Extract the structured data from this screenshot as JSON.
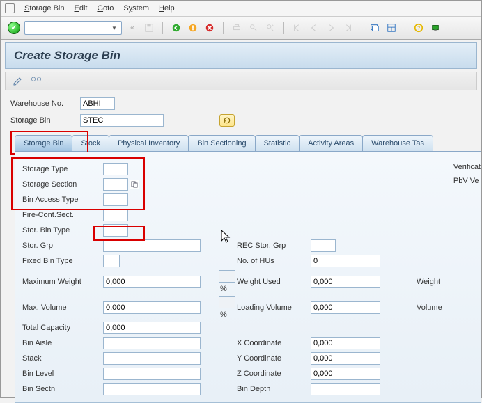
{
  "menu": {
    "storage_bin": "Storage Bin",
    "edit": "Edit",
    "goto": "Goto",
    "system": "System",
    "help": "Help"
  },
  "title": "Create Storage Bin",
  "header": {
    "warehouse_label": "Warehouse No.",
    "warehouse_val": "ABHI",
    "storage_bin_label": "Storage Bin",
    "storage_bin_val": "STEC"
  },
  "tabs": {
    "storage_bin": "Storage Bin",
    "stock": "Stock",
    "physical_inventory": "Physical Inventory",
    "bin_sectioning": "Bin Sectioning",
    "statistic": "Statistic",
    "activity_areas": "Activity Areas",
    "warehouse_tas": "Warehouse Tas"
  },
  "form": {
    "storage_type": "Storage Type",
    "storage_section": "Storage Section",
    "bin_access_type": "Bin Access Type",
    "fire_cont_sect": "Fire-Cont.Sect.",
    "stor_bin_type": "Stor. Bin Type",
    "stor_grp": "Stor. Grp",
    "fixed_bin_type": "Fixed Bin Type",
    "maximum_weight": "Maximum Weight",
    "max_volume": "Max. Volume",
    "total_capacity": "Total Capacity",
    "bin_aisle": "Bin Aisle",
    "stack": "Stack",
    "bin_level": "Bin Level",
    "bin_sectn": "Bin Sectn",
    "rec_stor_grp": "REC Stor. Grp",
    "no_of_hus": "No. of HUs",
    "weight_used": "Weight Used",
    "loading_volume": "Loading Volume",
    "x_coord": "X Coordinate",
    "y_coord": "Y Coordinate",
    "z_coord": "Z Coordinate",
    "bin_depth": "Bin Depth",
    "verificat": "Verificat",
    "pbv_ver": "PbV Ve",
    "weight_r": "Weight",
    "volume_r": "Volume"
  },
  "vals": {
    "zero": "0",
    "zerodec": "0,000"
  }
}
